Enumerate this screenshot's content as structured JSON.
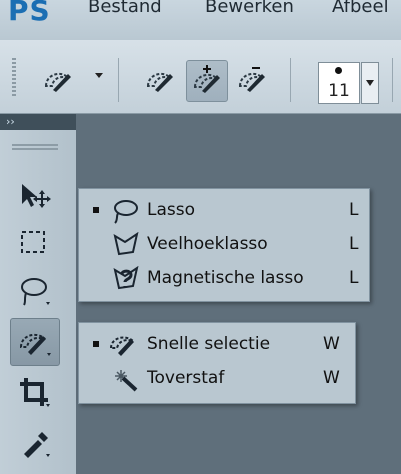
{
  "app": {
    "logo": "PS"
  },
  "menu": [
    "Bestand",
    "Bewerken",
    "Afbeel"
  ],
  "options_bar": {
    "tools": [
      {
        "icon": "quick-selection-icon",
        "has_dropdown": true
      },
      {
        "icon": "new-selection-icon",
        "state": "normal"
      },
      {
        "icon": "add-to-selection-icon",
        "state": "active"
      },
      {
        "icon": "subtract-from-selection-icon",
        "state": "normal"
      }
    ],
    "brush_size": "11"
  },
  "toolbar": {
    "header": "››",
    "tools": [
      {
        "icon": "move-icon"
      },
      {
        "icon": "marquee-icon"
      },
      {
        "icon": "lasso-icon"
      },
      {
        "icon": "quick-selection-icon",
        "active": true
      },
      {
        "icon": "crop-icon"
      },
      {
        "icon": "eyedropper-icon"
      }
    ]
  },
  "lasso_flyout": [
    {
      "label": "Lasso",
      "key": "L",
      "selected": true,
      "icon": "lasso-icon"
    },
    {
      "label": "Veelhoeklasso",
      "key": "L",
      "selected": false,
      "icon": "polygonal-lasso-icon"
    },
    {
      "label": "Magnetische lasso",
      "key": "L",
      "selected": false,
      "icon": "magnetic-lasso-icon"
    }
  ],
  "selection_flyout": [
    {
      "label": "Snelle selectie",
      "key": "W",
      "selected": true,
      "icon": "quick-selection-icon"
    },
    {
      "label": "Toverstaf",
      "key": "W",
      "selected": false,
      "icon": "magic-wand-icon"
    }
  ]
}
